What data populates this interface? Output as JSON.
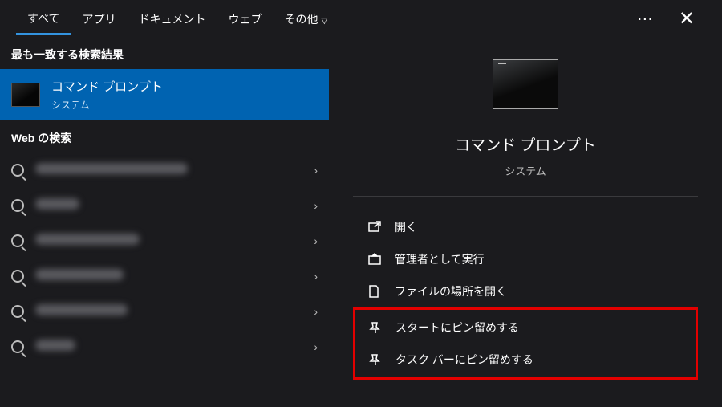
{
  "tabs": {
    "all": "すべて",
    "apps": "アプリ",
    "docs": "ドキュメント",
    "web": "ウェブ",
    "more": "その他"
  },
  "left": {
    "best_match_header": "最も一致する検索結果",
    "best_title": "コマンド プロンプト",
    "best_sub": "システム",
    "web_header": "Web の検索"
  },
  "preview": {
    "title": "コマンド プロンプト",
    "sub": "システム",
    "actions": {
      "open": "開く",
      "run_admin": "管理者として実行",
      "open_location": "ファイルの場所を開く",
      "pin_start": "スタートにピン留めする",
      "pin_taskbar": "タスク バーにピン留めする"
    }
  }
}
